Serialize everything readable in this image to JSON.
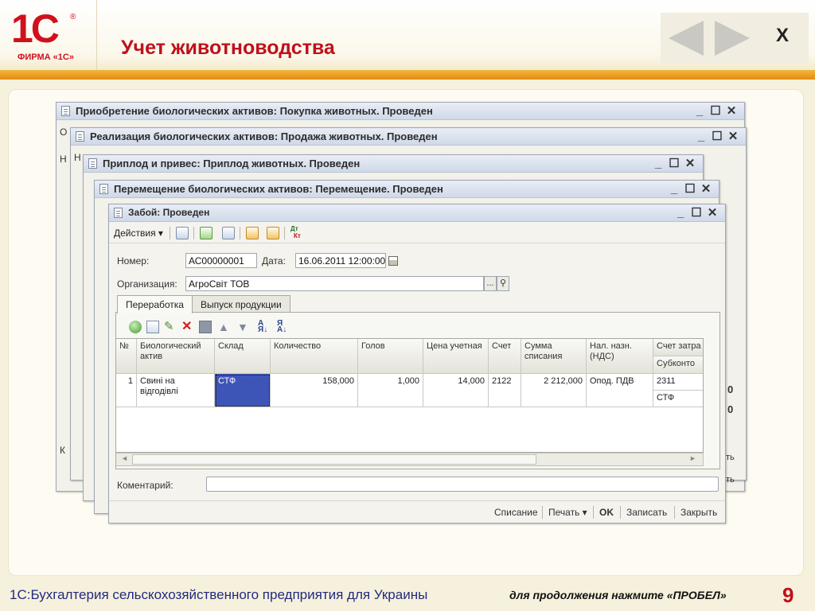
{
  "slide": {
    "logo_text": "1С",
    "logo_reg": "®",
    "logo_sub": "ФИРМА «1С»",
    "title": "Учет животноводства",
    "close_label": "X"
  },
  "windows": [
    {
      "title": "Приобретение биологических активов: Покупка животных. Проведен"
    },
    {
      "title": "Реализация биологических активов: Продажа животных. Проведен"
    },
    {
      "title": "Приплод и привес: Приплод животных. Проведен"
    },
    {
      "title": "Перемещение биологических активов: Перемещение. Проведен"
    }
  ],
  "window_controls": {
    "min": "_",
    "max": "☐",
    "close": "✕"
  },
  "front": {
    "title": "Забой: Проведен",
    "actions_label": "Действия ▾",
    "dt_label": "Дт",
    "kt_label": "Кт",
    "number_label": "Номер:",
    "number_value": "АС00000001",
    "date_label": "Дата:",
    "date_value": "16.06.2011 12:00:00",
    "org_label": "Организация:",
    "org_value": "АгроСвіт ТОВ",
    "ellipsis": "...",
    "tabs": [
      "Переработка",
      "Выпуск продукции"
    ],
    "columns": [
      "№",
      "Биологический актив",
      "Склад",
      "Количество",
      "Голов",
      "Цена учетная",
      "Счет",
      "Сумма списания",
      "Нал. назн. (НДС)",
      "Счет затра",
      "Субконто"
    ],
    "row": {
      "n": "1",
      "asset": "Свині на відгодівлі",
      "warehouse": "СТФ",
      "qty": "158,000",
      "heads": "1,000",
      "price": "14,000",
      "account": "2122",
      "amount": "2 212,000",
      "vat": "Опод. ПДВ",
      "cost_account": "2311",
      "subconto": "СТФ"
    },
    "comment_label": "Коментарий:",
    "comment_value": "",
    "bottom": [
      "Списание",
      "Печать ▾",
      "OK",
      "Записать",
      "Закрыть"
    ]
  },
  "edge_fragments": {
    "o": "О",
    "h": "Н",
    "k": "К",
    "zero": "0",
    "ht": "ть"
  },
  "footer": {
    "left": "1С:Бухгалтерия сельскохозяйственного предприятия для Украины",
    "hint": "для продолжения нажмите «ПРОБЕЛ»",
    "page": "9"
  }
}
